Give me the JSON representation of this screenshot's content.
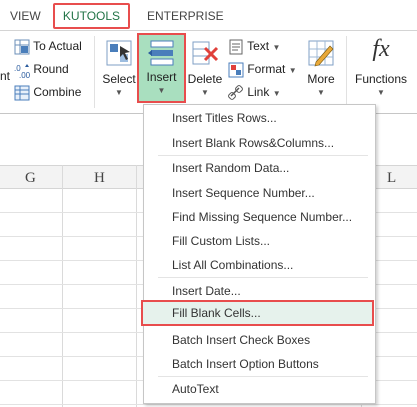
{
  "tabs": {
    "view": "VIEW",
    "kutools": "KUTOOLS",
    "enterprise": "ENTERPRISE"
  },
  "ribbon": {
    "left_group": {
      "partial_label": "nt",
      "to_actual": "To Actual",
      "round": "Round",
      "combine": "Combine"
    },
    "select": "Select",
    "insert": "Insert",
    "delete": "Delete",
    "text": "Text",
    "format": "Format",
    "link": "Link",
    "more": "More",
    "functions_glyph": "fx",
    "functions": "Functions"
  },
  "columns": [
    "G",
    "H",
    "L"
  ],
  "menu": {
    "items": [
      "Insert Titles Rows...",
      "Insert Blank Rows&Columns...",
      "Insert Random Data...",
      "Insert Sequence Number...",
      "Find Missing Sequence Number...",
      "Fill Custom Lists...",
      "List All Combinations...",
      "Insert Date...",
      "Fill Blank Cells...",
      "Batch Insert Check Boxes",
      "Batch Insert Option Buttons",
      "AutoText"
    ]
  },
  "colors": {
    "accent_green": "#217346",
    "highlight_red": "#e84d4d",
    "insert_green": "#a9dfbf"
  }
}
